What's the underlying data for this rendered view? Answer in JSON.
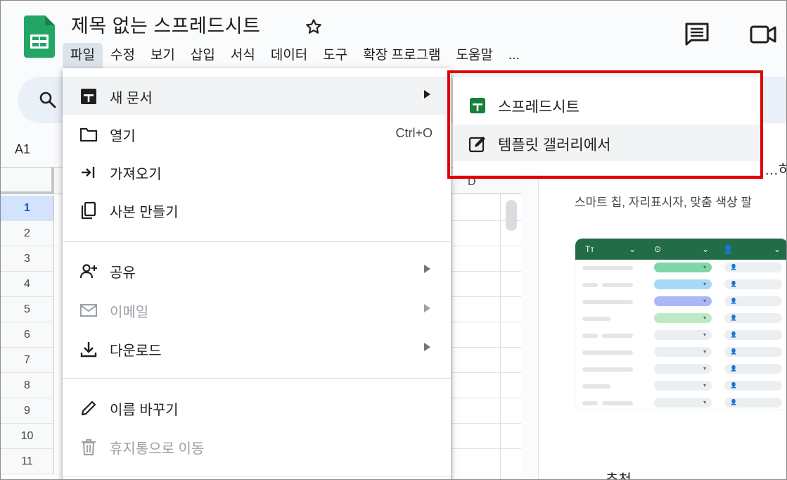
{
  "app": {
    "name": "Google Sheets"
  },
  "document": {
    "title": "제목 없는 스프레드시트"
  },
  "menubar": {
    "items": [
      "파일",
      "수정",
      "보기",
      "삽입",
      "서식",
      "데이터",
      "도구",
      "확장 프로그램",
      "도움말",
      "..."
    ]
  },
  "namebox": {
    "value": "A1"
  },
  "grid": {
    "column_header": "D",
    "rows": [
      "1",
      "2",
      "3",
      "4",
      "5",
      "6",
      "7",
      "8",
      "9",
      "10",
      "11"
    ],
    "selected_row": "1"
  },
  "file_menu": {
    "items": [
      {
        "label": "새 문서",
        "icon": "new-document-icon",
        "has_submenu": true,
        "highlighted": true
      },
      {
        "label": "열기",
        "icon": "folder-icon",
        "shortcut": "Ctrl+O"
      },
      {
        "label": "가져오기",
        "icon": "import-icon"
      },
      {
        "label": "사본 만들기",
        "icon": "copy-icon"
      },
      {
        "label": "공유",
        "icon": "add-person-icon",
        "has_submenu": true
      },
      {
        "label": "이메일",
        "icon": "mail-icon",
        "has_submenu": true,
        "disabled": true
      },
      {
        "label": "다운로드",
        "icon": "download-icon",
        "has_submenu": true
      },
      {
        "label": "이름 바꾸기",
        "icon": "pencil-icon"
      },
      {
        "label": "휴지통으로 이동",
        "icon": "trash-icon",
        "disabled": true
      }
    ]
  },
  "submenu": {
    "items": [
      {
        "label": "스프레드시트",
        "icon": "sheets-icon"
      },
      {
        "label": "템플릿 갤러리에서",
        "icon": "template-icon",
        "highlighted": true
      }
    ]
  },
  "side_panel": {
    "title_partial": "…하세",
    "description": "스마트 칩, 자리표시자, 맞춤 색상 팔",
    "bottom_partial": "추천",
    "preview_headers": [
      "Tт",
      "⊙",
      "👤"
    ]
  },
  "colors": {
    "highlight_box": "#e00000",
    "sheets_green": "#188038",
    "preview_header": "#226c47",
    "selected_row": "#d3e3fd"
  }
}
